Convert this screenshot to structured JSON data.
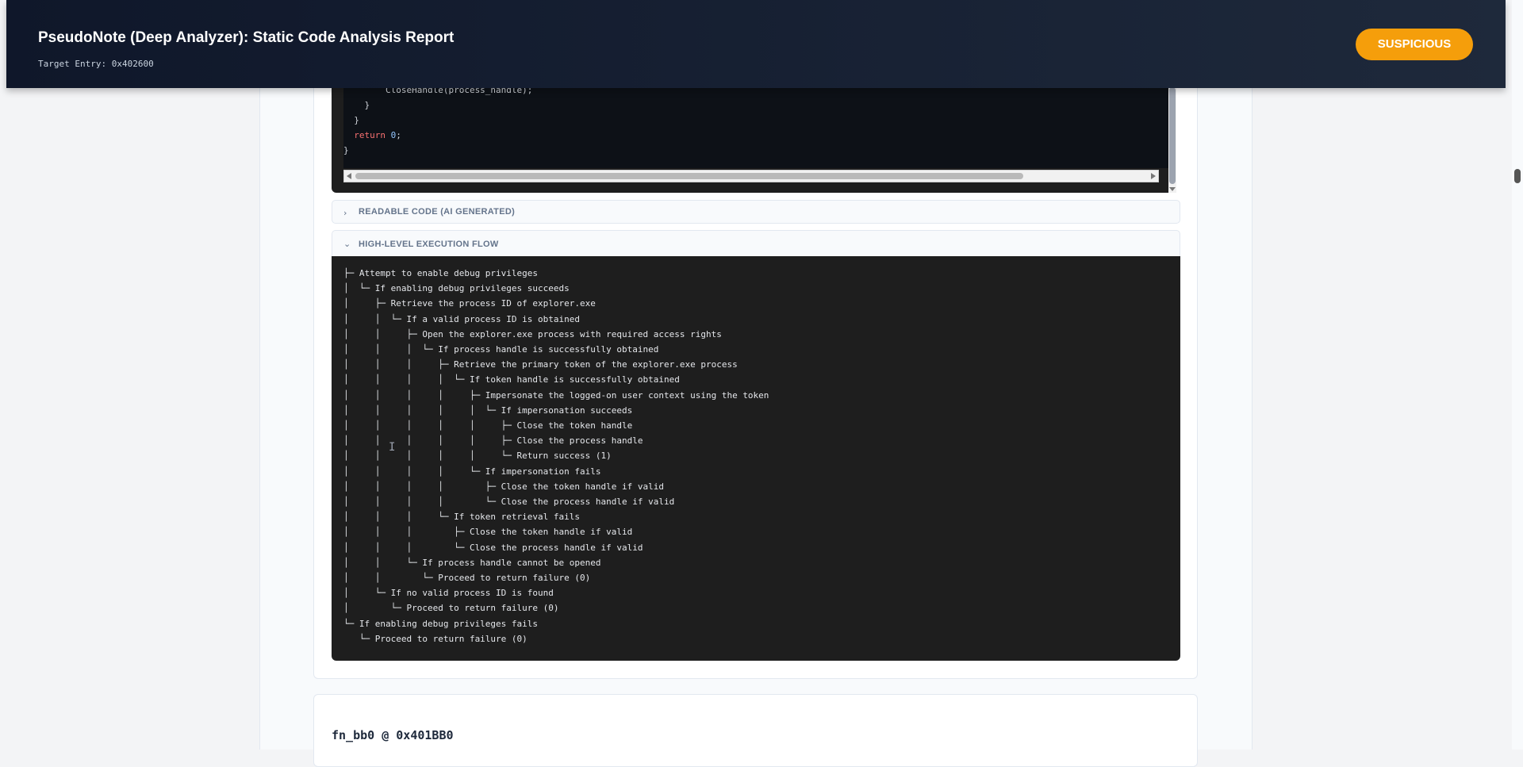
{
  "header": {
    "title": "PseudoNote (Deep Analyzer): Static Code Analysis Report",
    "target_entry": "Target Entry: 0x402600",
    "verdict": "SUSPICIOUS",
    "verdict_color": "#f59e0b"
  },
  "code": {
    "lines": [
      {
        "text": "        CloseHandle(process_handle);"
      },
      {
        "text": "    }"
      },
      {
        "text": "  }"
      }
    ],
    "return_kw": "return",
    "return_value": "0",
    "return_suffix": ";",
    "closing": "}"
  },
  "sections": {
    "readable": "READABLE CODE (AI GENERATED)",
    "flow": "HIGH-LEVEL EXECUTION FLOW"
  },
  "flow_lines": [
    "├─ Attempt to enable debug privileges",
    "│  └─ If enabling debug privileges succeeds",
    "│     ├─ Retrieve the process ID of explorer.exe",
    "│     │  └─ If a valid process ID is obtained",
    "│     │     ├─ Open the explorer.exe process with required access rights",
    "│     │     │  └─ If process handle is successfully obtained",
    "│     │     │     ├─ Retrieve the primary token of the explorer.exe process",
    "│     │     │     │  └─ If token handle is successfully obtained",
    "│     │     │     │     ├─ Impersonate the logged-on user context using the token",
    "│     │     │     │     │  └─ If impersonation succeeds",
    "│     │     │     │     │     ├─ Close the token handle",
    "│     │     │     │     │     ├─ Close the process handle",
    "│     │     │     │     │     └─ Return success (1)",
    "│     │     │     │     └─ If impersonation fails",
    "│     │     │     │        ├─ Close the token handle if valid",
    "│     │     │     │        └─ Close the process handle if valid",
    "│     │     │     └─ If token retrieval fails",
    "│     │     │        ├─ Close the token handle if valid",
    "│     │     │        └─ Close the process handle if valid",
    "│     │     └─ If process handle cannot be opened",
    "│     │        └─ Proceed to return failure (0)",
    "│     └─ If no valid process ID is found",
    "│        └─ Proceed to return failure (0)",
    "└─ If enabling debug privileges fails",
    "   └─ Proceed to return failure (0)"
  ],
  "next_function": "fn_bb0 @ 0x401BB0"
}
